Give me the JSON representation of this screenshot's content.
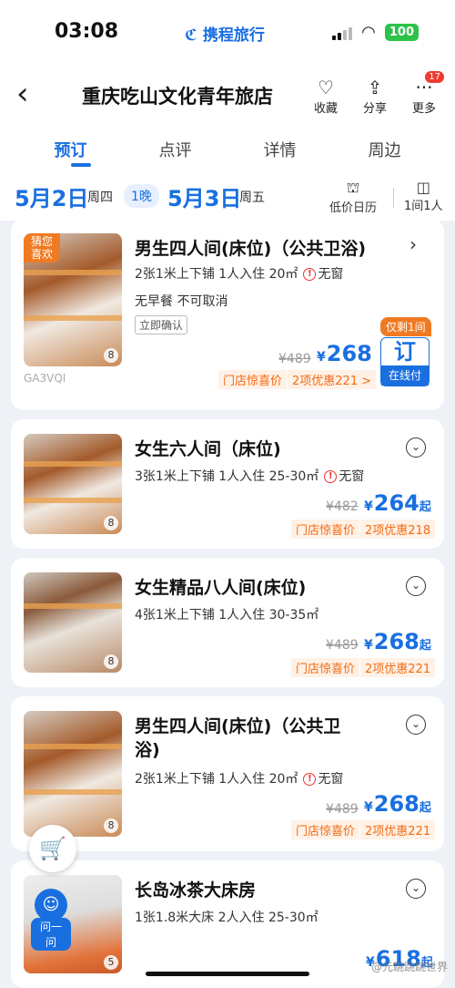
{
  "status": {
    "time": "03:08",
    "app_logo": "携程旅行",
    "battery": "100"
  },
  "nav": {
    "title": "重庆吃山文化青年旅店",
    "favorite": "收藏",
    "share": "分享",
    "more": "更多",
    "more_badge": "17"
  },
  "tabs": [
    "预订",
    "点评",
    "详情",
    "周边"
  ],
  "dates": {
    "checkin": "5月2日",
    "checkin_week": "周四",
    "nights": "1晚",
    "checkout": "5月3日",
    "checkout_week": "周五",
    "calendar": "低价日历",
    "rooms_guests": "1间1人"
  },
  "rooms": [
    {
      "name": "男生四人间(床位)（公共卫浴)",
      "spec": "2张1米上下铺 1人入住 20㎡",
      "window": "无窗",
      "spec2": "无早餐 不可取消",
      "confirm": "立即确认",
      "photo_count": "8",
      "tag": "猜您喜欢",
      "code": "GA3VQI",
      "old_price": "¥489",
      "price": "268",
      "promo1": "门店惊喜价",
      "promo2": "2项优惠221 >",
      "remain": "仅剩1间",
      "book": "订",
      "book_sub": "在线付"
    },
    {
      "name": "女生六人间（床位)",
      "spec": "3张1米上下铺 1人入住 25-30㎡",
      "window": "无窗",
      "photo_count": "8",
      "old_price": "¥482",
      "price": "264",
      "promo1": "门店惊喜价",
      "promo2": "2项优惠218"
    },
    {
      "name": "女生精品八人间(床位)",
      "spec": "4张1米上下铺 1人入住 30-35㎡",
      "photo_count": "8",
      "old_price": "¥489",
      "price": "268",
      "promo1": "门店惊喜价",
      "promo2": "2项优惠221"
    },
    {
      "name_line1": "男生四人间(床位)（公共卫",
      "name_line2": "浴)",
      "spec": "2张1米上下铺 1人入住 20㎡",
      "window": "无窗",
      "photo_count": "8",
      "old_price": "¥489",
      "price": "268",
      "promo1": "门店惊喜价",
      "promo2": "2项优惠221"
    },
    {
      "name": "长岛冰茶大床房",
      "spec": "1张1.8米大床 2人入住 25-30㎡",
      "photo_count": "5",
      "price": "618"
    }
  ],
  "price_suffix": "起",
  "yen": "¥",
  "ask": "问一问",
  "watermark": "@元跳跳跳世界",
  "colors": {
    "brand_blue": "#1a6fe0",
    "promo_orange": "#f36b12",
    "tag_orange": "#f07a22"
  }
}
